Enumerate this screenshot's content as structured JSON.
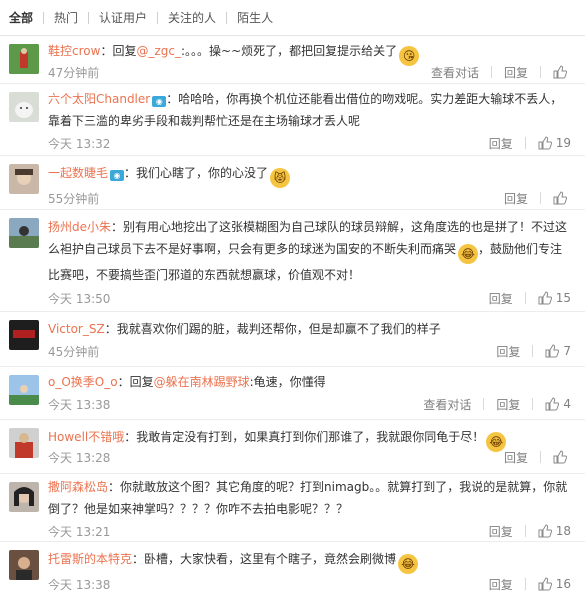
{
  "tabs": [
    "全部",
    "热门",
    "认证用户",
    "关注的人",
    "陌生人"
  ],
  "labels": {
    "view_conversation": "查看对话",
    "reply": "回复"
  },
  "comments": [
    {
      "user": "鞋控crow",
      "sep": "：",
      "text_prefix": "回复",
      "mention": "@_zgc_",
      "text": ":。。。操~~烦死了，都把回复提示给关了",
      "time": "47分钟前",
      "likes": "",
      "avatar_color": "#3a7a3a",
      "emoji": "😘"
    },
    {
      "user": "六个太阳Chandler",
      "sep": "：",
      "text": "哈哈哈，你再换个机位还能看出借位的吻戏呢。实力差距大输球不丢人，靠着下三滥的卑劣手段和裁判帮忙还是在主场输球才丢人呢",
      "time": "今天 13:32",
      "likes": "19",
      "avatar_color": "#cfd6d0"
    },
    {
      "user": "一起数睫毛",
      "sep": "：",
      "text": "我们心瞎了，你的心没了",
      "time": "55分钟前",
      "likes": "",
      "avatar_color": "#9a8a7a",
      "emoji": "😾"
    },
    {
      "user": "扬州de小朱",
      "sep": "：",
      "text": "别有用心地挖出了这张模糊图为自己球队的球员辩解，这角度选的也是拼了！不过这么袒护自己球员下去不是好事啊，只会有更多的球迷为国安的不断失利而痛哭",
      "text2": "，鼓励他们专注比赛吧，不要搞些歪门邪道的东西就想赢球，价值观不对！",
      "time": "今天 13:50",
      "likes": "15",
      "avatar_color": "#6f8fa8",
      "emoji": "😂"
    },
    {
      "user": "Victor_SZ",
      "sep": "：",
      "text": "我就喜欢你们踢的脏，裁判还帮你，但是却赢不了我们的样子",
      "time": "45分钟前",
      "likes": "7",
      "avatar_color": "#2a2a2a"
    },
    {
      "user": "o_O换季O_o",
      "sep": "：",
      "text_prefix": "回复",
      "mention": "@躲在南林踢野球",
      "text": ":龟速，你懂得",
      "time": "今天 13:38",
      "likes": "4",
      "avatar_color": "#6f9fd0"
    },
    {
      "user": "Howell不错哦",
      "sep": "：",
      "text": "我敢肯定没有打到，如果真打到你们那谁了，我就跟你同龟于尽！",
      "time": "今天 13:28",
      "likes": "",
      "avatar_color": "#b04030",
      "emoji": "😂"
    },
    {
      "user": "撒阿森松岛",
      "sep": "：",
      "text": "你就敢放这个图？其它角度的呢？打到nimagb。。就算打到了，我说的是就算，你就倒了？他是如来神掌吗？？？？你咋不去拍电影呢？？？",
      "time": "今天 13:21",
      "likes": "18",
      "avatar_color": "#3a3a3a"
    },
    {
      "user": "托雷斯的本特克",
      "sep": "：",
      "text": "卧槽，大家快看，这里有个瞎子，竟然会刷微博",
      "time": "今天 13:38",
      "likes": "16",
      "avatar_color": "#8a6a50",
      "emoji": "😂"
    }
  ]
}
